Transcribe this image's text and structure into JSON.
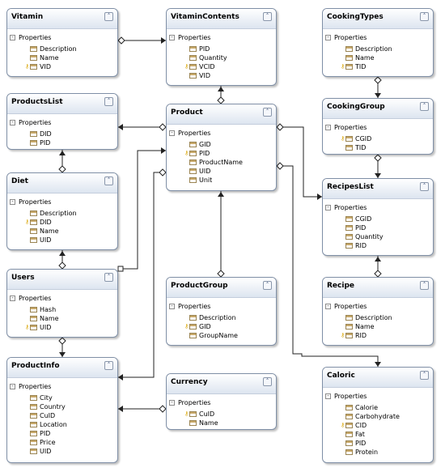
{
  "section_label": "Properties",
  "entities": [
    {
      "id": "vitamin",
      "name": "Vitamin",
      "fields": [
        {
          "name": "Description",
          "key": false
        },
        {
          "name": "Name",
          "key": false
        },
        {
          "name": "VID",
          "key": true
        }
      ]
    },
    {
      "id": "vitamincontents",
      "name": "VitaminContents",
      "fields": [
        {
          "name": "PID",
          "key": false
        },
        {
          "name": "Quantity",
          "key": false
        },
        {
          "name": "VCID",
          "key": true
        },
        {
          "name": "VID",
          "key": false
        }
      ]
    },
    {
      "id": "cookingtypes",
      "name": "CookingTypes",
      "fields": [
        {
          "name": "Description",
          "key": false
        },
        {
          "name": "Name",
          "key": false
        },
        {
          "name": "TID",
          "key": true
        }
      ]
    },
    {
      "id": "productslist",
      "name": "ProductsList",
      "fields": [
        {
          "name": "DID",
          "key": false
        },
        {
          "name": "PID",
          "key": false
        }
      ]
    },
    {
      "id": "product",
      "name": "Product",
      "fields": [
        {
          "name": "GID",
          "key": false
        },
        {
          "name": "PID",
          "key": true
        },
        {
          "name": "ProductName",
          "key": false
        },
        {
          "name": "UID",
          "key": false
        },
        {
          "name": "Unit",
          "key": false
        }
      ]
    },
    {
      "id": "cookinggroup",
      "name": "CookingGroup",
      "fields": [
        {
          "name": "CGID",
          "key": true
        },
        {
          "name": "TID",
          "key": false
        }
      ]
    },
    {
      "id": "diet",
      "name": "Diet",
      "fields": [
        {
          "name": "Description",
          "key": false
        },
        {
          "name": "DID",
          "key": true
        },
        {
          "name": "Name",
          "key": false
        },
        {
          "name": "UID",
          "key": false
        }
      ]
    },
    {
      "id": "recipeslist",
      "name": "RecipesList",
      "fields": [
        {
          "name": "CGID",
          "key": false
        },
        {
          "name": "PID",
          "key": false
        },
        {
          "name": "Quantity",
          "key": false
        },
        {
          "name": "RID",
          "key": false
        }
      ]
    },
    {
      "id": "users",
      "name": "Users",
      "fields": [
        {
          "name": "Hash",
          "key": false
        },
        {
          "name": "Name",
          "key": false
        },
        {
          "name": "UID",
          "key": true
        }
      ]
    },
    {
      "id": "productgroup",
      "name": "ProductGroup",
      "fields": [
        {
          "name": "Description",
          "key": false
        },
        {
          "name": "GID",
          "key": true
        },
        {
          "name": "GroupName",
          "key": false
        }
      ]
    },
    {
      "id": "recipe",
      "name": "Recipe",
      "fields": [
        {
          "name": "Description",
          "key": false
        },
        {
          "name": "Name",
          "key": false
        },
        {
          "name": "RID",
          "key": true
        }
      ]
    },
    {
      "id": "productinfo",
      "name": "ProductInfo",
      "fields": [
        {
          "name": "City",
          "key": false
        },
        {
          "name": "Country",
          "key": false
        },
        {
          "name": "CuID",
          "key": false
        },
        {
          "name": "Location",
          "key": false
        },
        {
          "name": "PID",
          "key": false
        },
        {
          "name": "Price",
          "key": false
        },
        {
          "name": "UID",
          "key": false
        }
      ]
    },
    {
      "id": "currency",
      "name": "Currency",
      "fields": [
        {
          "name": "CuID",
          "key": true
        },
        {
          "name": "Name",
          "key": false
        }
      ]
    },
    {
      "id": "caloric",
      "name": "Caloric",
      "fields": [
        {
          "name": "Calorie",
          "key": false
        },
        {
          "name": "Carbohydrate",
          "key": false
        },
        {
          "name": "CID",
          "key": true
        },
        {
          "name": "Fat",
          "key": false
        },
        {
          "name": "PID",
          "key": false
        },
        {
          "name": "Protein",
          "key": false
        }
      ]
    }
  ]
}
